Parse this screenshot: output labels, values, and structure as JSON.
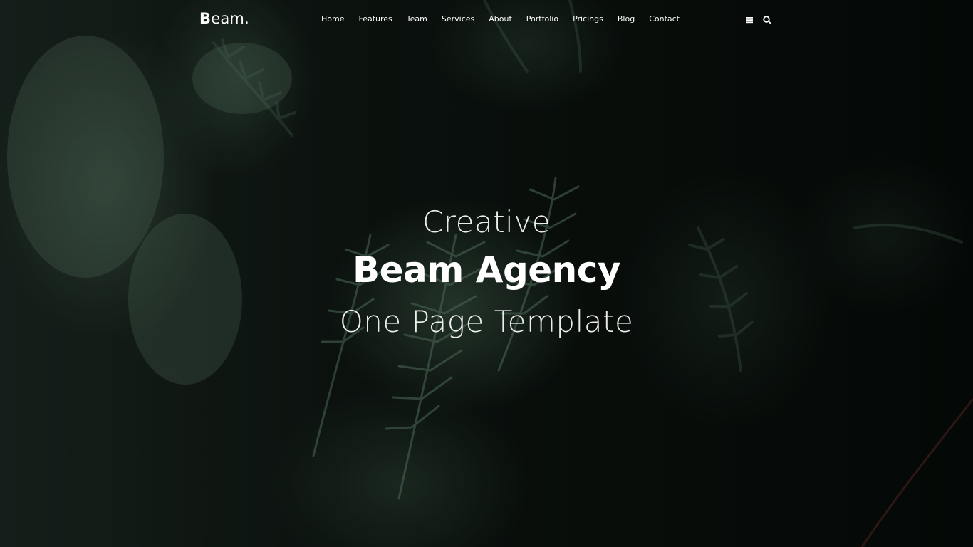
{
  "header": {
    "logo_main": "B",
    "logo_rest": "eam.",
    "menu": [
      {
        "label": "Home"
      },
      {
        "label": "Features"
      },
      {
        "label": "Team"
      },
      {
        "label": "Services"
      },
      {
        "label": "About"
      },
      {
        "label": "Portfolio"
      },
      {
        "label": "Pricings"
      },
      {
        "label": "Blog"
      },
      {
        "label": "Contact"
      }
    ],
    "icons": {
      "menu": "hamburger-menu-icon",
      "search": "search-icon"
    }
  },
  "hero": {
    "line1": "Creative",
    "line2": "Beam Agency",
    "line3": "One Page Template"
  },
  "colors": {
    "text": "#ffffff",
    "background": "#0b120e",
    "foliage": "#4f6e5b"
  }
}
